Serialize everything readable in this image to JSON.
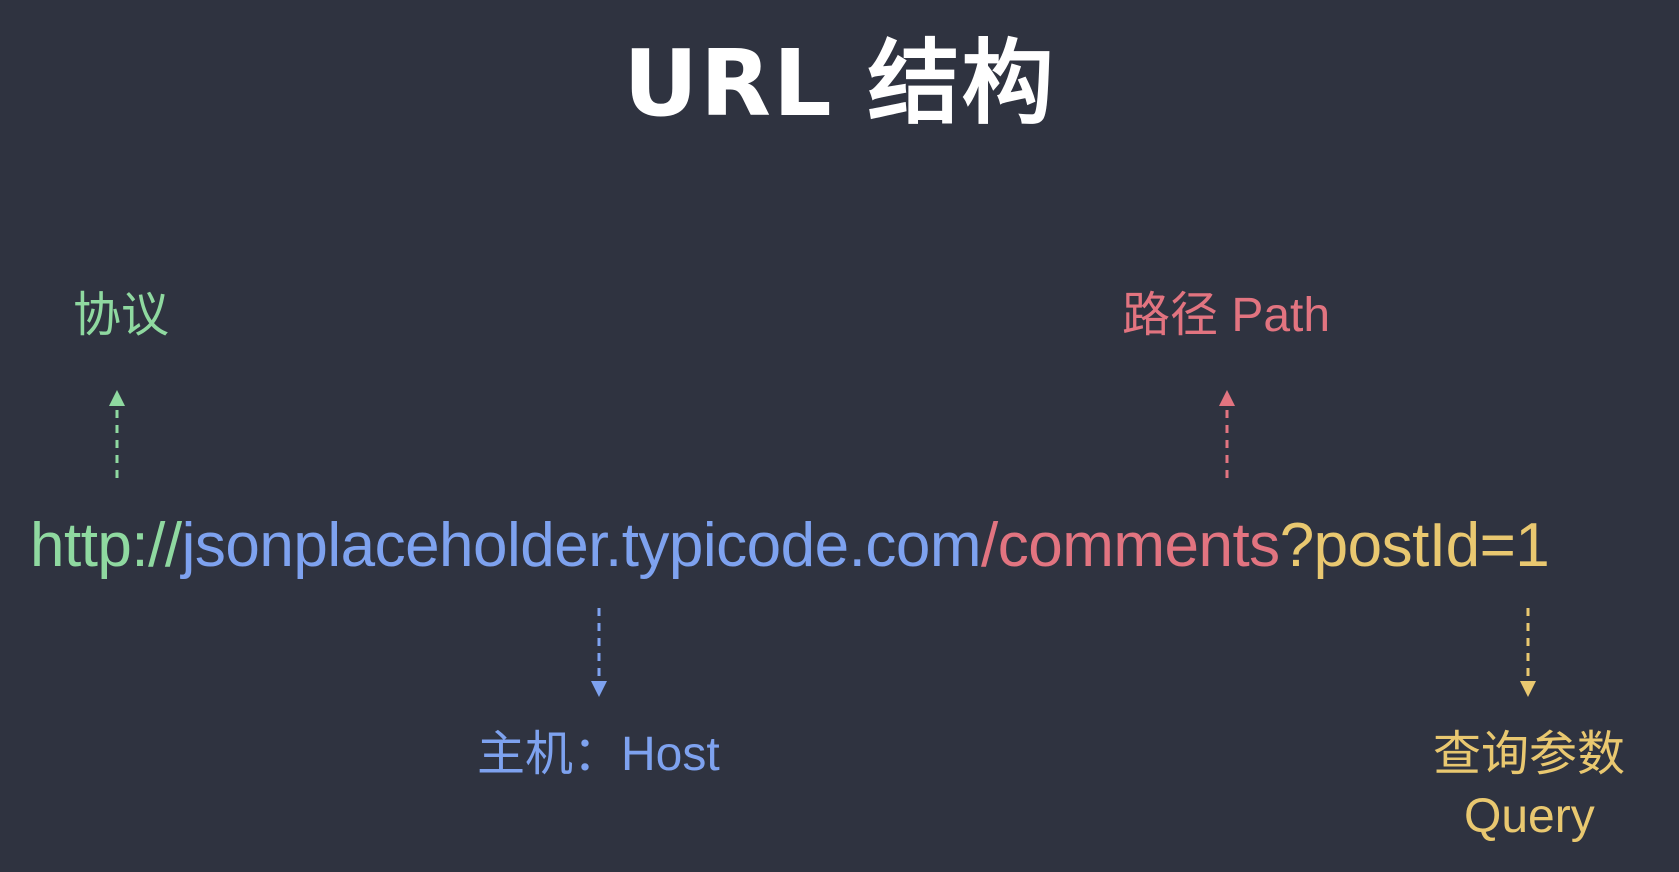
{
  "title": "URL 结构",
  "url": {
    "protocol": "http://",
    "host": "jsonplaceholder.typicode.com",
    "path": "/comments",
    "query": "?postId=1"
  },
  "labels": {
    "protocol": "协议",
    "path": "路径 Path",
    "host": "主机：Host",
    "query_cn": "查询参数",
    "query_en": "Query"
  },
  "colors": {
    "background": "#2f3340",
    "protocol": "#8fd9a0",
    "host": "#7ea2ef",
    "path": "#e27480",
    "query": "#e9c870",
    "title": "#ffffff"
  }
}
